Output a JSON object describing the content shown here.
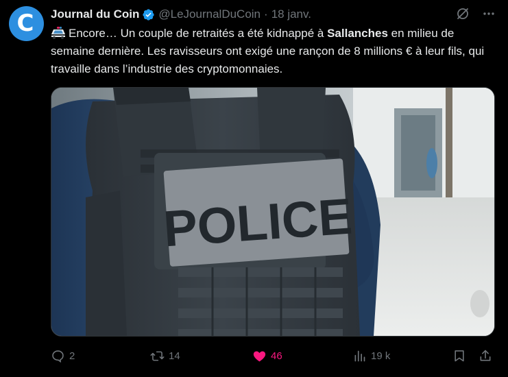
{
  "author": {
    "avatar_letter": "C",
    "display_name": "Journal du Coin",
    "handle": "@LeJournalDuCoin",
    "separator": "·",
    "date": "18 janv."
  },
  "tweet": {
    "emoji": "police-car-emoji",
    "text_before": "Encore… Un couple de retraités a été kidnappé à ",
    "text_bold": "Sallanches",
    "text_after": " en milieu de semaine dernière. Les ravisseurs ont exigé une rançon de 8 millions € à leur fils, qui travaille dans l’industrie des cryptomonnaies."
  },
  "media": {
    "vest_patch_text": "POLICE"
  },
  "actions": {
    "replies": "2",
    "reposts": "14",
    "likes": "46",
    "views": "19 k"
  },
  "colors": {
    "background": "#000000",
    "text": "#e7e9ea",
    "muted": "#71767b",
    "like": "#f91880",
    "verified": "#1d9bf0",
    "avatar": "#2d8fe0"
  }
}
